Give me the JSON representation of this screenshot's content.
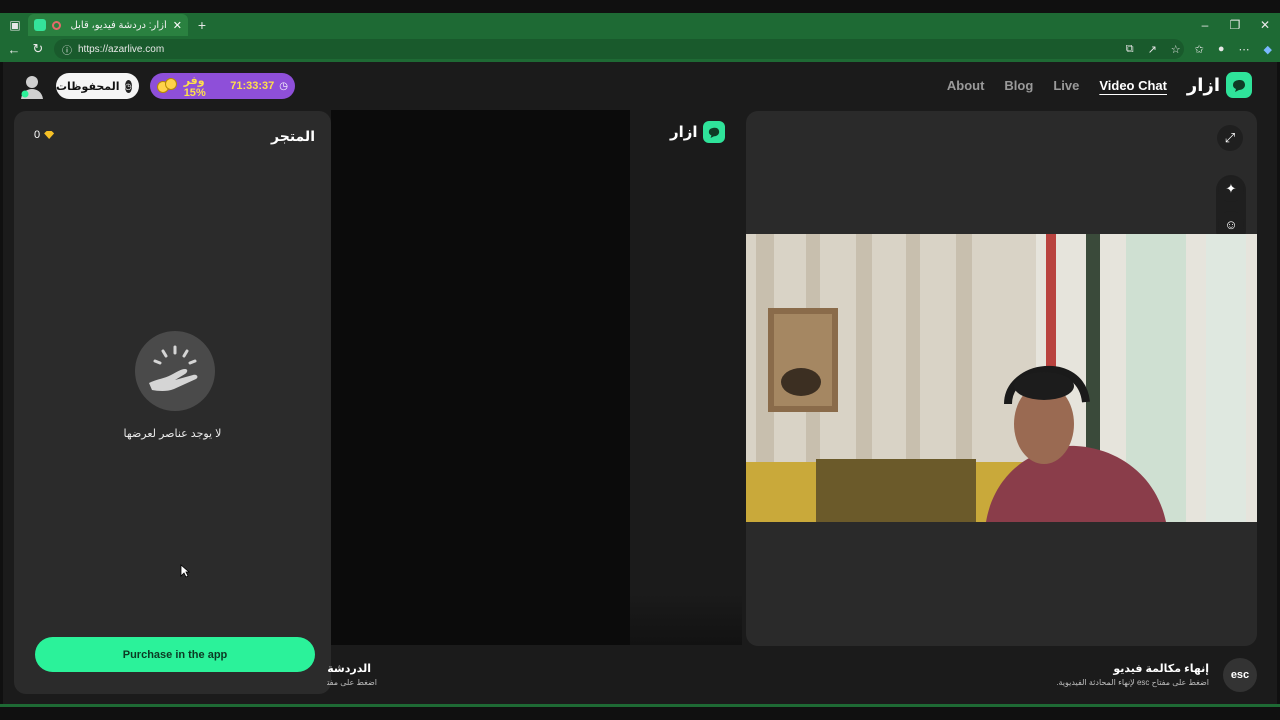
{
  "browser": {
    "tab_title": "أزار: دردشة فيديو، قابل الأصدقاء",
    "url": "https://azarlive.com"
  },
  "header": {
    "saved_label": "المحفوظات",
    "promo_timer": "71:33:37",
    "promo_text": "وفر 15%",
    "nav": [
      "About",
      "Blog",
      "Live",
      "Video Chat"
    ],
    "active_nav": "Video Chat",
    "logo_text": "ازار"
  },
  "store": {
    "title": "المتجر",
    "gem_count": "0",
    "empty_text": "لا يوجد عناصر لعرضها",
    "purchase_label": "Purchase in the app"
  },
  "remote": {
    "logo_text": "ازار"
  },
  "footer": {
    "end_call_title": "إنهاء مكالمة فيديو",
    "end_call_hint": "اضغط على مفتاح esc لإنهاء المحادثة الفيديوية.",
    "esc_label": "esc",
    "left_caption_title": "الدردشة ب",
    "left_caption_hint": "اضغط على مفتاح"
  },
  "colors": {
    "browser_green": "#1e6a34",
    "brand_green": "#2bf29a",
    "promo_purple": "#8e4fd9"
  }
}
